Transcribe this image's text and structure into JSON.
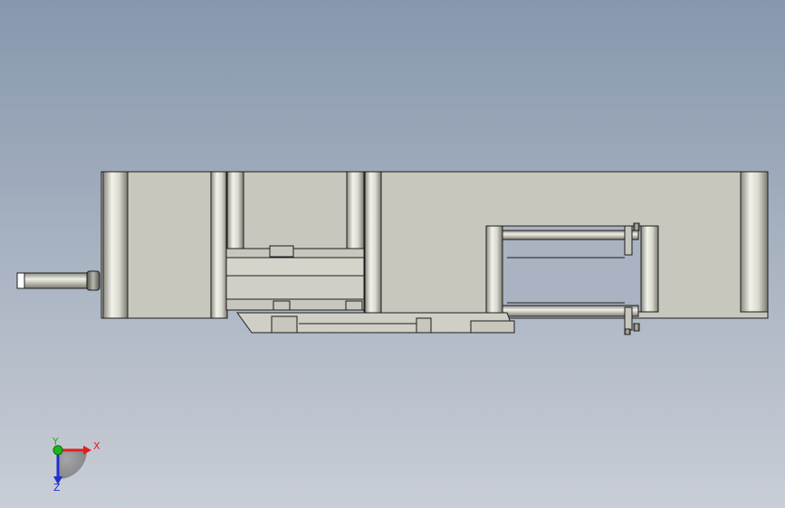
{
  "viewport": {
    "background_top": "#8797ad",
    "background_bottom": "#c9ced6"
  },
  "model": {
    "body_color": "#c7c7bd",
    "edge_color": "#1e1e1e",
    "shadow_color": "#6f6f68"
  },
  "triad": {
    "x_label": "X",
    "y_label": "Y",
    "z_label": "Z",
    "x_color": "#e02020",
    "y_color": "#18b818",
    "z_color": "#2030d0"
  }
}
